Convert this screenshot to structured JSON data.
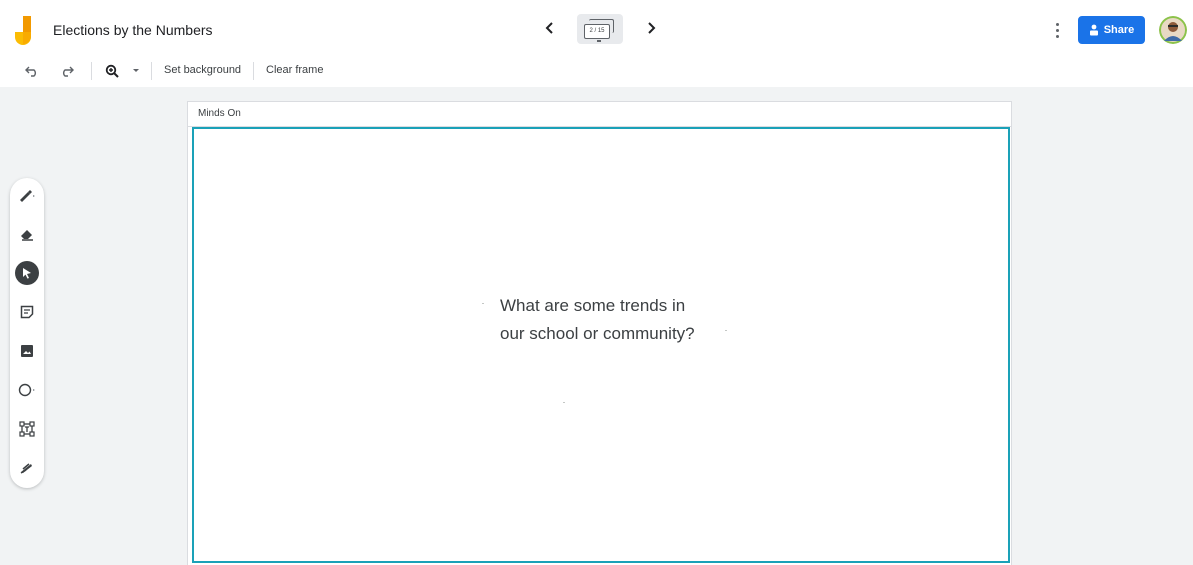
{
  "app": {
    "title": "Elections by the Numbers",
    "frame_counter": "2 / 15"
  },
  "header": {
    "share_label": "Share",
    "prev_icon": "chevron-left-icon",
    "next_icon": "chevron-right-icon",
    "more_icon": "more-vert-icon"
  },
  "toolbar": {
    "undo_icon": "undo-icon",
    "redo_icon": "redo-icon",
    "zoom_icon": "zoom-in-icon",
    "set_background_label": "Set background",
    "clear_frame_label": "Clear frame"
  },
  "tools": [
    {
      "name": "pen-icon"
    },
    {
      "name": "eraser-icon"
    },
    {
      "name": "select-icon",
      "active": true
    },
    {
      "name": "sticky-note-icon"
    },
    {
      "name": "image-icon"
    },
    {
      "name": "circle-icon"
    },
    {
      "name": "text-box-icon"
    },
    {
      "name": "laser-icon"
    }
  ],
  "frame": {
    "label": "Minds On",
    "question_line1": "What are some trends in",
    "question_line2": "our school or community?"
  },
  "colors": {
    "accent": "#1a73e8",
    "frame_border": "#1aa1b8",
    "logo_yellow": "#fbbc04",
    "logo_orange": "#f29900"
  }
}
